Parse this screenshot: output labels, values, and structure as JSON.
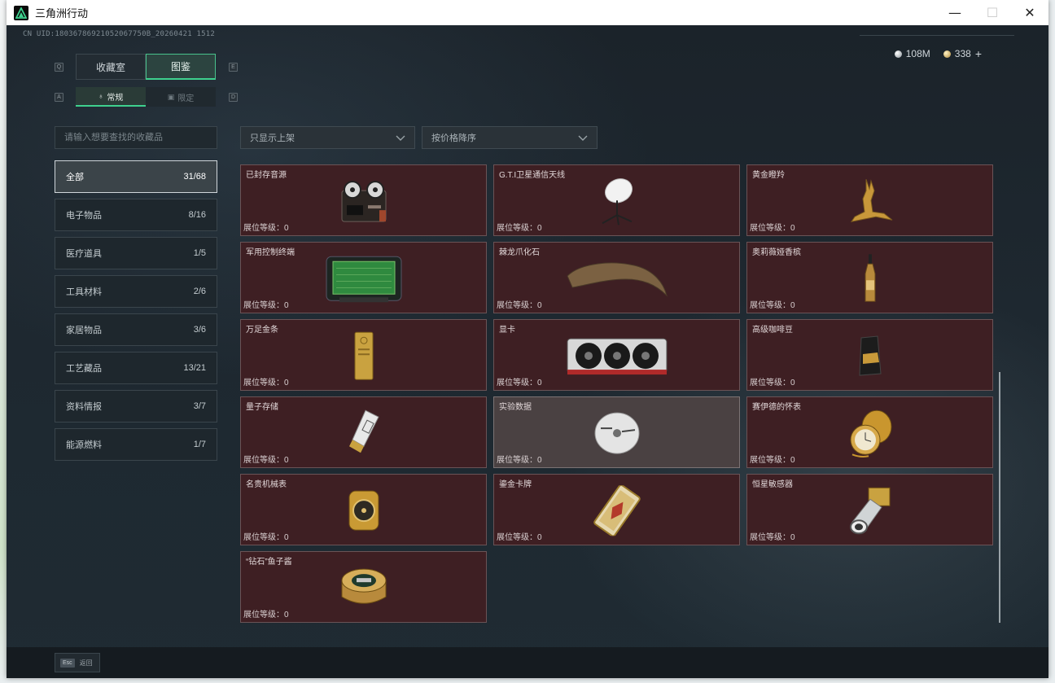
{
  "window": {
    "title": "三角洲行动",
    "minimize_glyph": "—",
    "maximize_glyph": "☐",
    "close_glyph": "✕"
  },
  "header": {
    "uid": "CN UID:18036786921052067750B_20260421 1512",
    "currency": [
      {
        "icon": "silver-coin-icon",
        "value": "108M"
      },
      {
        "icon": "gold-coin-icon",
        "value": "338"
      }
    ],
    "add_label": "+"
  },
  "tabs": {
    "key_left": "Q",
    "key_right": "E",
    "items": [
      {
        "label": "收藏室",
        "active": false
      },
      {
        "label": "图鉴",
        "active": true
      }
    ]
  },
  "subtabs": {
    "key_left": "A",
    "key_right": "D",
    "items": [
      {
        "label": "常规",
        "icon": "regular-icon",
        "active": true
      },
      {
        "label": "限定",
        "icon": "limited-icon",
        "active": false
      }
    ]
  },
  "search": {
    "placeholder": "请输入想要查找的收藏品"
  },
  "filters": {
    "listing": "只显示上架",
    "sort": "按价格降序"
  },
  "categories": [
    {
      "label": "全部",
      "count": "31/68",
      "active": true
    },
    {
      "label": "电子物品",
      "count": "8/16"
    },
    {
      "label": "医疗道具",
      "count": "1/5"
    },
    {
      "label": "工具材料",
      "count": "2/6"
    },
    {
      "label": "家居物品",
      "count": "3/6"
    },
    {
      "label": "工艺藏品",
      "count": "13/21"
    },
    {
      "label": "资料情报",
      "count": "3/7"
    },
    {
      "label": "能源燃料",
      "count": "1/7"
    }
  ],
  "items": [
    {
      "name": "已封存音源",
      "level": "展位等级：0",
      "icon": "tape-recorder-icon"
    },
    {
      "name": "G.T.I卫星通信天线",
      "level": "展位等级：0",
      "icon": "satellite-dish-icon"
    },
    {
      "name": "黄金瞪羚",
      "level": "展位等级：0",
      "icon": "golden-gazelle-icon"
    },
    {
      "name": "军用控制终端",
      "level": "展位等级：0",
      "icon": "military-terminal-icon"
    },
    {
      "name": "棘龙爪化石",
      "level": "展位等级：0",
      "icon": "claw-fossil-icon"
    },
    {
      "name": "奥莉薇娅香槟",
      "level": "展位等级：0",
      "icon": "champagne-bottle-icon"
    },
    {
      "name": "万足金条",
      "level": "展位等级：0",
      "icon": "gold-bar-icon"
    },
    {
      "name": "显卡",
      "level": "展位等级：0",
      "icon": "graphics-card-icon"
    },
    {
      "name": "高级咖啡豆",
      "level": "展位等级：0",
      "icon": "coffee-bag-icon"
    },
    {
      "name": "量子存储",
      "level": "展位等级：0",
      "icon": "quantum-storage-icon"
    },
    {
      "name": "实验数据",
      "level": "展位等级：0",
      "icon": "data-disc-icon",
      "selected": true
    },
    {
      "name": "赛伊德的怀表",
      "level": "展位等级：0",
      "icon": "pocket-watch-icon"
    },
    {
      "name": "名贵机械表",
      "level": "展位等级：0",
      "icon": "wristwatch-icon"
    },
    {
      "name": "鎏金卡牌",
      "level": "展位等级：0",
      "icon": "gilded-card-icon"
    },
    {
      "name": "恒星敏感器",
      "level": "展位等级：0",
      "icon": "star-sensor-icon"
    },
    {
      "name": "“钻石”鱼子酱",
      "level": "展位等级：0",
      "icon": "caviar-tin-icon"
    }
  ],
  "footer": {
    "esc_key": "Esc",
    "back_label": "返回"
  },
  "colors": {
    "accent": "#3ed18e",
    "card_bg": "#3e1f23",
    "card_selected": "#4a4142"
  }
}
